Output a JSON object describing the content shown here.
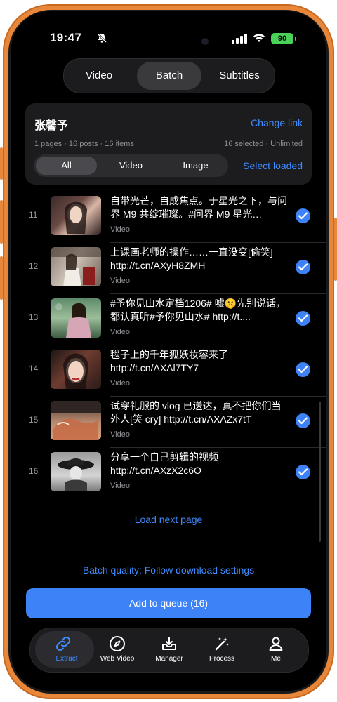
{
  "status_bar": {
    "time": "19:47",
    "battery": "90"
  },
  "mode_tabs": [
    {
      "label": "Video",
      "active": false
    },
    {
      "label": "Batch",
      "active": true
    },
    {
      "label": "Subtitles",
      "active": false
    }
  ],
  "source_card": {
    "author": "张馨予",
    "change_link": "Change link",
    "meta": "1 pages · 16 posts · 16 items",
    "selection": "16 selected · Unlimited",
    "filters": [
      {
        "label": "All",
        "active": true
      },
      {
        "label": "Video",
        "active": false
      },
      {
        "label": "Image",
        "active": false
      }
    ],
    "select_loaded": "Select loaded"
  },
  "items": [
    {
      "index": "11",
      "title": "自带光芒，自成焦点。于星光之下，与问界 M9 共绽璀璨。#问界 M9 星光…",
      "type": "Video",
      "selected": true
    },
    {
      "index": "12",
      "title": "上课画老师的操作……一直没变[偷笑] http://t.cn/AXyH8ZMH",
      "type": "Video",
      "selected": true
    },
    {
      "index": "13",
      "title": "#予你见山水定档1206# 嘘🤫先别说话，都认真听#予你见山水# http://t....",
      "type": "Video",
      "selected": true
    },
    {
      "index": "14",
      "title": "毯子上的千年狐妖妆容来了 http://t.cn/AXAl7TY7",
      "type": "Video",
      "selected": true
    },
    {
      "index": "15",
      "title": "试穿礼服的 vlog 已送达，真不把你们当外人[笑 cry] http://t.cn/AXAZx7tT",
      "type": "Video",
      "selected": true
    },
    {
      "index": "16",
      "title": "分享一个自己剪辑的视频 http://t.cn/AXzX2c6O",
      "type": "Video",
      "selected": true
    }
  ],
  "load_next": "Load next page",
  "batch_quality": "Batch quality: Follow download settings",
  "queue_button": "Add to queue (16)",
  "tab_bar": [
    {
      "label": "Extract",
      "icon": "link-icon",
      "active": true
    },
    {
      "label": "Web Video",
      "icon": "compass-icon",
      "active": false
    },
    {
      "label": "Manager",
      "icon": "download-tray-icon",
      "active": false
    },
    {
      "label": "Process",
      "icon": "magic-wand-icon",
      "active": false
    },
    {
      "label": "Me",
      "icon": "person-icon",
      "active": false
    }
  ],
  "colors": {
    "accent": "#3d82f7",
    "link": "#3f8cff",
    "frame": "#e8863a",
    "battery": "#49d25a"
  }
}
